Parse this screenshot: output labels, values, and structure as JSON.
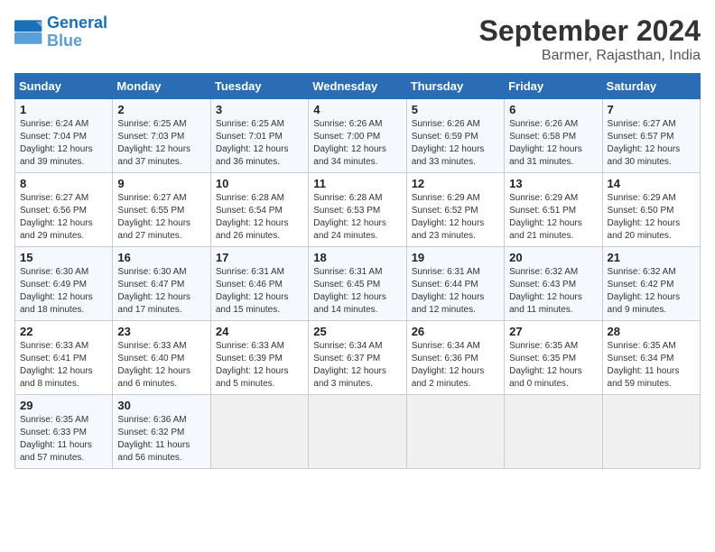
{
  "logo": {
    "line1": "General",
    "line2": "Blue"
  },
  "title": "September 2024",
  "subtitle": "Barmer, Rajasthan, India",
  "headers": [
    "Sunday",
    "Monday",
    "Tuesday",
    "Wednesday",
    "Thursday",
    "Friday",
    "Saturday"
  ],
  "weeks": [
    [
      {
        "day": "1",
        "sunrise": "6:24 AM",
        "sunset": "7:04 PM",
        "daylight": "12 hours and 39 minutes."
      },
      {
        "day": "2",
        "sunrise": "6:25 AM",
        "sunset": "7:03 PM",
        "daylight": "12 hours and 37 minutes."
      },
      {
        "day": "3",
        "sunrise": "6:25 AM",
        "sunset": "7:01 PM",
        "daylight": "12 hours and 36 minutes."
      },
      {
        "day": "4",
        "sunrise": "6:26 AM",
        "sunset": "7:00 PM",
        "daylight": "12 hours and 34 minutes."
      },
      {
        "day": "5",
        "sunrise": "6:26 AM",
        "sunset": "6:59 PM",
        "daylight": "12 hours and 33 minutes."
      },
      {
        "day": "6",
        "sunrise": "6:26 AM",
        "sunset": "6:58 PM",
        "daylight": "12 hours and 31 minutes."
      },
      {
        "day": "7",
        "sunrise": "6:27 AM",
        "sunset": "6:57 PM",
        "daylight": "12 hours and 30 minutes."
      }
    ],
    [
      {
        "day": "8",
        "sunrise": "6:27 AM",
        "sunset": "6:56 PM",
        "daylight": "12 hours and 29 minutes."
      },
      {
        "day": "9",
        "sunrise": "6:27 AM",
        "sunset": "6:55 PM",
        "daylight": "12 hours and 27 minutes."
      },
      {
        "day": "10",
        "sunrise": "6:28 AM",
        "sunset": "6:54 PM",
        "daylight": "12 hours and 26 minutes."
      },
      {
        "day": "11",
        "sunrise": "6:28 AM",
        "sunset": "6:53 PM",
        "daylight": "12 hours and 24 minutes."
      },
      {
        "day": "12",
        "sunrise": "6:29 AM",
        "sunset": "6:52 PM",
        "daylight": "12 hours and 23 minutes."
      },
      {
        "day": "13",
        "sunrise": "6:29 AM",
        "sunset": "6:51 PM",
        "daylight": "12 hours and 21 minutes."
      },
      {
        "day": "14",
        "sunrise": "6:29 AM",
        "sunset": "6:50 PM",
        "daylight": "12 hours and 20 minutes."
      }
    ],
    [
      {
        "day": "15",
        "sunrise": "6:30 AM",
        "sunset": "6:49 PM",
        "daylight": "12 hours and 18 minutes."
      },
      {
        "day": "16",
        "sunrise": "6:30 AM",
        "sunset": "6:47 PM",
        "daylight": "12 hours and 17 minutes."
      },
      {
        "day": "17",
        "sunrise": "6:31 AM",
        "sunset": "6:46 PM",
        "daylight": "12 hours and 15 minutes."
      },
      {
        "day": "18",
        "sunrise": "6:31 AM",
        "sunset": "6:45 PM",
        "daylight": "12 hours and 14 minutes."
      },
      {
        "day": "19",
        "sunrise": "6:31 AM",
        "sunset": "6:44 PM",
        "daylight": "12 hours and 12 minutes."
      },
      {
        "day": "20",
        "sunrise": "6:32 AM",
        "sunset": "6:43 PM",
        "daylight": "12 hours and 11 minutes."
      },
      {
        "day": "21",
        "sunrise": "6:32 AM",
        "sunset": "6:42 PM",
        "daylight": "12 hours and 9 minutes."
      }
    ],
    [
      {
        "day": "22",
        "sunrise": "6:33 AM",
        "sunset": "6:41 PM",
        "daylight": "12 hours and 8 minutes."
      },
      {
        "day": "23",
        "sunrise": "6:33 AM",
        "sunset": "6:40 PM",
        "daylight": "12 hours and 6 minutes."
      },
      {
        "day": "24",
        "sunrise": "6:33 AM",
        "sunset": "6:39 PM",
        "daylight": "12 hours and 5 minutes."
      },
      {
        "day": "25",
        "sunrise": "6:34 AM",
        "sunset": "6:37 PM",
        "daylight": "12 hours and 3 minutes."
      },
      {
        "day": "26",
        "sunrise": "6:34 AM",
        "sunset": "6:36 PM",
        "daylight": "12 hours and 2 minutes."
      },
      {
        "day": "27",
        "sunrise": "6:35 AM",
        "sunset": "6:35 PM",
        "daylight": "12 hours and 0 minutes."
      },
      {
        "day": "28",
        "sunrise": "6:35 AM",
        "sunset": "6:34 PM",
        "daylight": "11 hours and 59 minutes."
      }
    ],
    [
      {
        "day": "29",
        "sunrise": "6:35 AM",
        "sunset": "6:33 PM",
        "daylight": "11 hours and 57 minutes."
      },
      {
        "day": "30",
        "sunrise": "6:36 AM",
        "sunset": "6:32 PM",
        "daylight": "11 hours and 56 minutes."
      },
      null,
      null,
      null,
      null,
      null
    ]
  ]
}
